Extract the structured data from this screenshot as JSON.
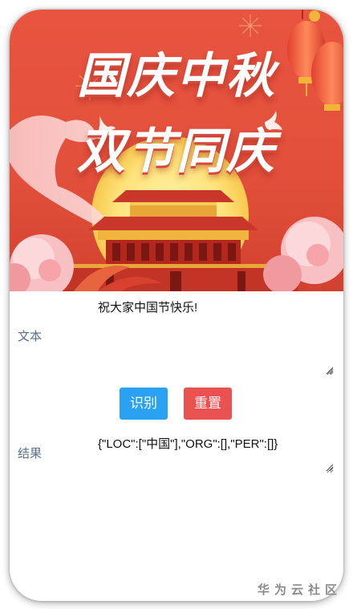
{
  "banner": {
    "title_line1": "国庆中秋",
    "title_line2": "双节同庆"
  },
  "input": {
    "label": "文本",
    "value": "祝大家中国节快乐!"
  },
  "buttons": {
    "recognize_label": "识别",
    "reset_label": "重置"
  },
  "result": {
    "label": "结果",
    "value": "{\"LOC\":[\"中国\"],\"ORG\":[],\"PER\":[]}"
  },
  "watermark": "华为云社区",
  "colors": {
    "banner_red": "#e04a36",
    "primary_button": "#2aa1f2",
    "danger_button": "#ea5151",
    "label_text": "#5a6f8a"
  }
}
